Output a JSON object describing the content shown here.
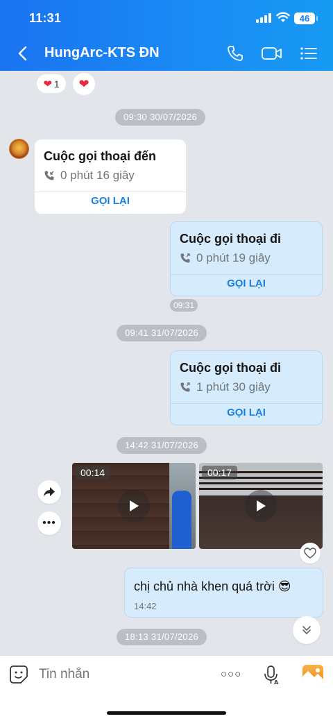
{
  "status_bar": {
    "time": "11:31",
    "battery": "46"
  },
  "header": {
    "title": "HungArc-KTS ĐN"
  },
  "reactions": {
    "heart_count": "1"
  },
  "messages": {
    "pill1": "09:30 30/07/2026",
    "call1": {
      "title": "Cuộc gọi thoại đến",
      "duration": "0 phút 16 giây",
      "action": "GỌI LẠI"
    },
    "call2": {
      "title": "Cuộc gọi thoại đi",
      "duration": "0 phút 19 giây",
      "action": "GỌI LẠI",
      "time": "09:31"
    },
    "pill2": "09:41 31/07/2026",
    "call3": {
      "title": "Cuộc gọi thoại đi",
      "duration": "1 phút 30 giây",
      "action": "GỌI LẠI"
    },
    "pill3": "14:42 31/07/2026",
    "video1": {
      "duration": "00:14"
    },
    "video2": {
      "duration": "00:17"
    },
    "text1": {
      "text": "chị chủ nhà khen quá trời 😎",
      "time": "14:42"
    },
    "pill4": "18:13 31/07/2026"
  },
  "composer": {
    "placeholder": "Tin nhắn"
  },
  "colors": {
    "header": "#1a80f2",
    "accent": "#1a7fe0",
    "outgoing_bubble": "#d6ecfd"
  }
}
